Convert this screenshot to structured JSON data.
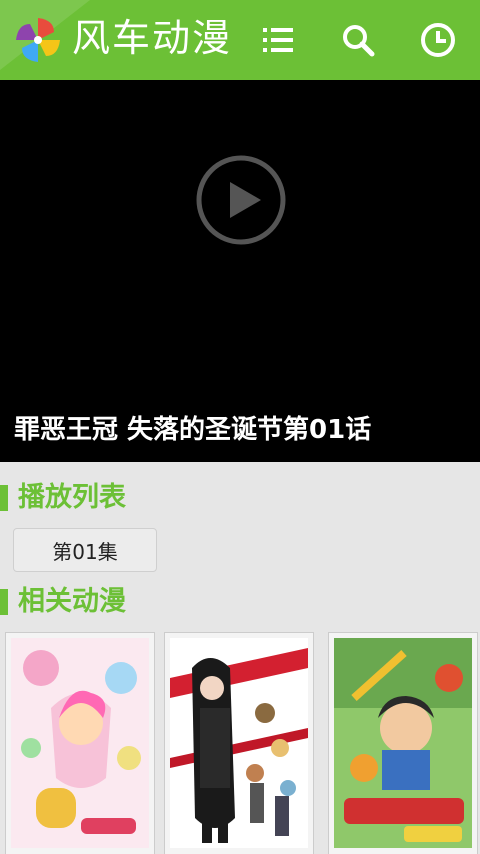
{
  "header": {
    "app_title": "风车动漫",
    "background_color": "#6cc036",
    "icons": [
      "pinwheel-logo-icon",
      "list-icon",
      "search-icon",
      "history-clock-icon"
    ]
  },
  "video": {
    "title": "罪恶王冠 失落的圣诞节第01话",
    "background_color": "#000000",
    "icon": "play-icon"
  },
  "playlist": {
    "heading": "播放列表",
    "episodes": [
      "第01集"
    ]
  },
  "related": {
    "heading": "相关动漫",
    "items": [
      {
        "poster": "magical-girl-anime-poster"
      },
      {
        "poster": "guilty-crown-style-poster"
      },
      {
        "poster": "adventure-anime-poster"
      }
    ]
  },
  "accent_color": "#6cc036"
}
